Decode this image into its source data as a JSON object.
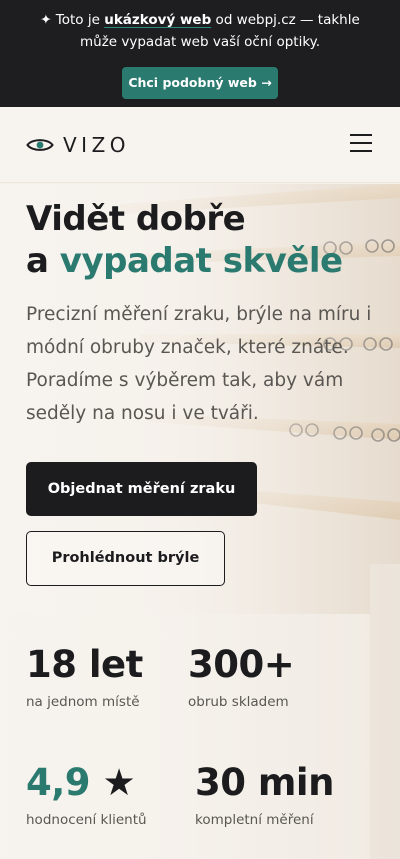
{
  "promo": {
    "prefix": "✦ Toto je ",
    "highlight": "ukázkový web",
    "suffix": " od webpj.cz — takhle může vypadat web vaší oční optiky.",
    "cta": "Chci podobný web →"
  },
  "header": {
    "logo_text": "VIZO",
    "menu_icon": "hamburger-menu-icon"
  },
  "hero": {
    "title_line1": "Vidět dobře",
    "title_prefix": "a ",
    "title_accent": "vypadat skvěle",
    "lead": "Precizní měření zraku, brýle na míru i módní obruby značek, které znáte. Poradíme s výběrem tak, aby vám seděly na nosu i ve tváři.",
    "primary_button": "Objednat měření zraku",
    "secondary_button": "Prohlédnout brýle"
  },
  "stats": [
    {
      "value": "18 let",
      "label": "na jednom místě"
    },
    {
      "value": "300+",
      "label": "obrub skladem"
    },
    {
      "value": "4,9",
      "star": "★",
      "label": "hodnocení klientů"
    },
    {
      "value": "30 min",
      "label": "kompletní měření"
    }
  ],
  "colors": {
    "accent": "#2b7a70",
    "dark": "#1c1c1e",
    "background": "#f4efe8"
  }
}
